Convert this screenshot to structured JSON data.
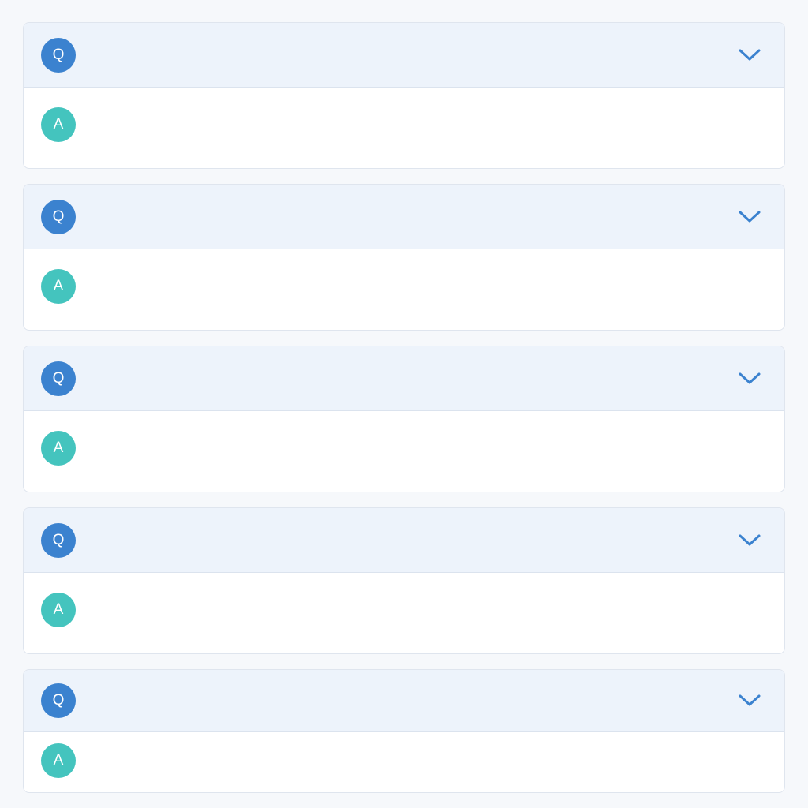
{
  "colors": {
    "page_background": "#f6f8fb",
    "question_header": "#edf3fb",
    "question_badge": "#3b82cf",
    "answer_badge": "#44c4be",
    "chevron": "#3b82cf",
    "card_border": "#dfe5ee"
  },
  "faq": {
    "items": [
      {
        "question_badge": "Q",
        "answer_badge": "A",
        "question": "",
        "answer": "",
        "toggle_icon": "chevron-down-icon"
      },
      {
        "question_badge": "Q",
        "answer_badge": "A",
        "question": "",
        "answer": "",
        "toggle_icon": "chevron-down-icon"
      },
      {
        "question_badge": "Q",
        "answer_badge": "A",
        "question": "",
        "answer": "",
        "toggle_icon": "chevron-down-icon"
      },
      {
        "question_badge": "Q",
        "answer_badge": "A",
        "question": "",
        "answer": "",
        "toggle_icon": "chevron-down-icon"
      },
      {
        "question_badge": "Q",
        "answer_badge": "A",
        "question": "",
        "answer": "",
        "toggle_icon": "chevron-down-icon"
      }
    ]
  }
}
